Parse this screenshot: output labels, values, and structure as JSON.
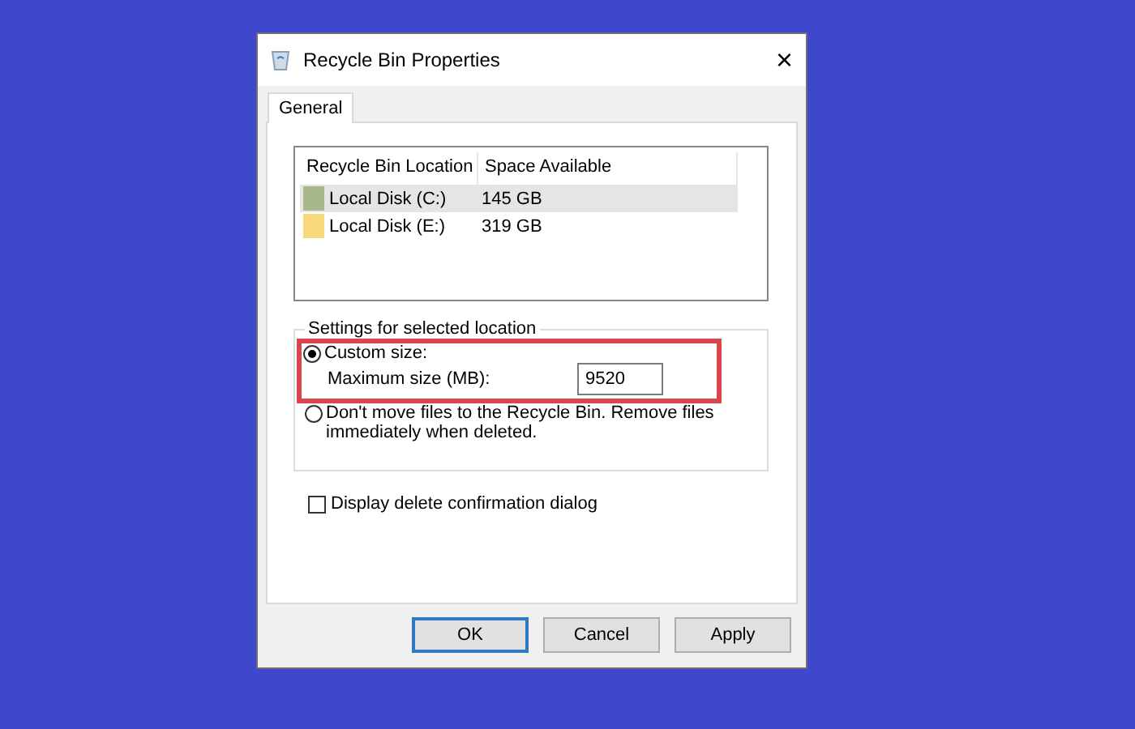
{
  "window": {
    "title": "Recycle Bin Properties",
    "close": "×"
  },
  "tabs": [
    {
      "label": "General",
      "selected": true
    }
  ],
  "table": {
    "columns": [
      "Recycle Bin Location",
      "Space Available"
    ],
    "rows": [
      {
        "location": "Local Disk (C:)",
        "space": "145 GB",
        "color": "#a9b88c",
        "selected": true
      },
      {
        "location": "Local Disk (E:)",
        "space": "319 GB",
        "color": "#f5d97a",
        "selected": false
      }
    ]
  },
  "settings": {
    "title": "Settings for selected location",
    "options": [
      {
        "label": "Custom size:",
        "selected": true,
        "highlighted": true
      },
      {
        "label": "Don't move files to the Recycle Bin. Remove files immediately when deleted.",
        "selected": false,
        "highlighted": false
      }
    ],
    "max_size_label": "Maximum size (MB):",
    "max_size_value": "9520"
  },
  "confirm": {
    "label": "Display delete confirmation dialog",
    "checked": false
  },
  "buttons": [
    {
      "label": "OK",
      "default": true
    },
    {
      "label": "Cancel",
      "default": false
    },
    {
      "label": "Apply",
      "default": false
    }
  ]
}
